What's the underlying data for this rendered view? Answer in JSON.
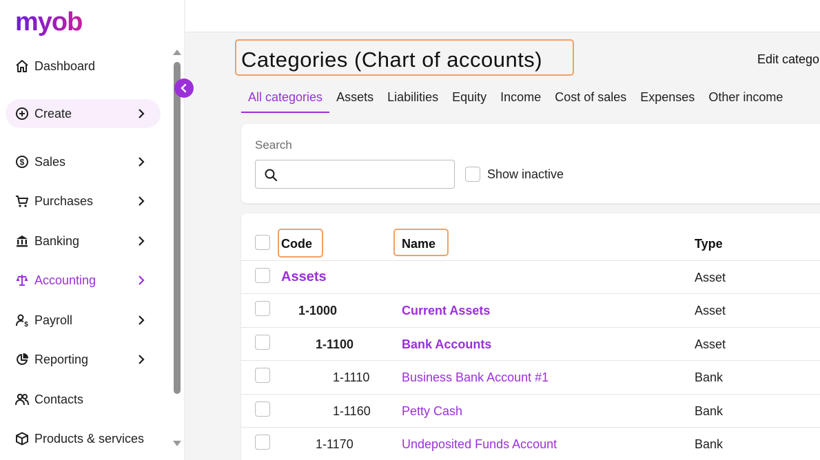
{
  "app": {
    "logo_text": "myob"
  },
  "sidebar": {
    "items": [
      {
        "label": "Dashboard",
        "icon": "home-icon",
        "has_chevron": false
      },
      {
        "label": "Create",
        "icon": "plus-circle-icon",
        "has_chevron": true
      },
      {
        "label": "Sales",
        "icon": "dollar-circle-icon",
        "has_chevron": true
      },
      {
        "label": "Purchases",
        "icon": "cart-icon",
        "has_chevron": true
      },
      {
        "label": "Banking",
        "icon": "bank-icon",
        "has_chevron": true
      },
      {
        "label": "Accounting",
        "icon": "scales-icon",
        "has_chevron": true,
        "active": true
      },
      {
        "label": "Payroll",
        "icon": "payroll-person-icon",
        "has_chevron": true
      },
      {
        "label": "Reporting",
        "icon": "pie-chart-icon",
        "has_chevron": true
      },
      {
        "label": "Contacts",
        "icon": "people-icon",
        "has_chevron": false
      },
      {
        "label": "Products & services",
        "icon": "box-icon",
        "has_chevron": false
      }
    ]
  },
  "header": {
    "title": "Categories (Chart of accounts)",
    "edit_button": "Edit catego"
  },
  "tabs": [
    "All categories",
    "Assets",
    "Liabilities",
    "Equity",
    "Income",
    "Cost of sales",
    "Expenses",
    "Other income"
  ],
  "active_tab": "All categories",
  "search": {
    "label": "Search",
    "value": "",
    "placeholder": "",
    "show_inactive_label": "Show inactive"
  },
  "table": {
    "headers": {
      "code": "Code",
      "name": "Name",
      "type": "Type"
    },
    "rows": [
      {
        "code": "",
        "name": "Assets",
        "type": "Asset",
        "level": 0
      },
      {
        "code": "1-1000",
        "name": "Current Assets",
        "type": "Asset",
        "level": 1
      },
      {
        "code": "1-1100",
        "name": "Bank Accounts",
        "type": "Asset",
        "level": 2
      },
      {
        "code": "1-1110",
        "name": "Business Bank Account #1",
        "type": "Bank",
        "level": 3
      },
      {
        "code": "1-1160",
        "name": "Petty Cash",
        "type": "Bank",
        "level": 3
      },
      {
        "code": "1-1170",
        "name": "Undeposited Funds Account",
        "type": "Bank",
        "level": 2
      }
    ]
  },
  "colors": {
    "accent": "#9b30d9",
    "highlight_outline": "#f2a063",
    "create_bg": "#f8eefc"
  }
}
